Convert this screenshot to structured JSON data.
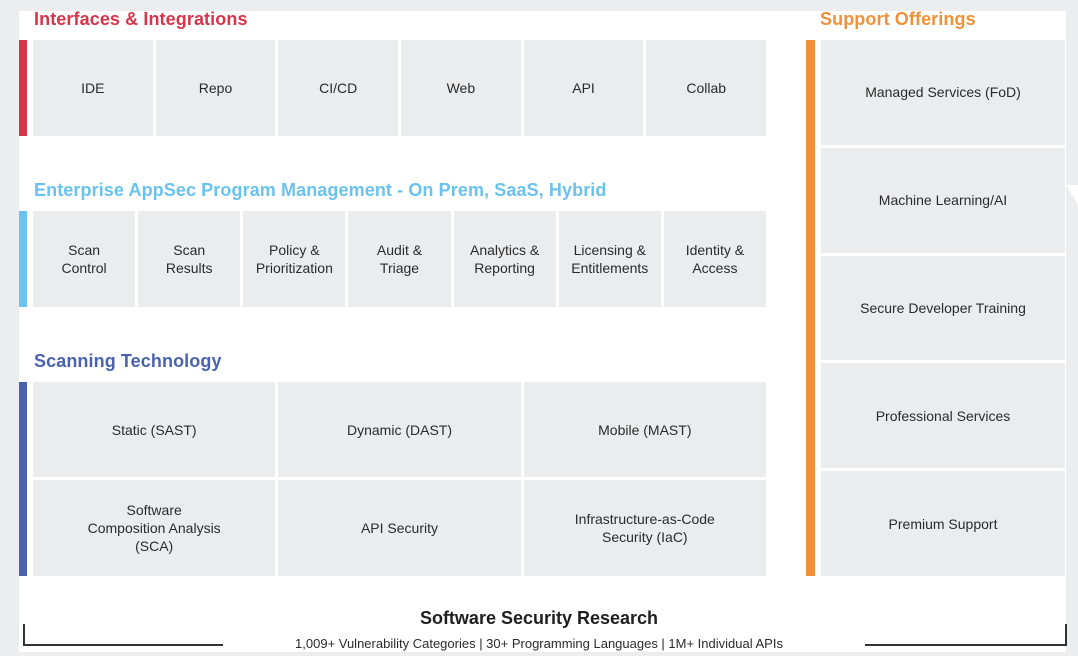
{
  "colors": {
    "interfaces": "#d9344a",
    "enterprise": "#6ac2ee",
    "scanning": "#4a63b0",
    "support": "#f0913a"
  },
  "interfaces": {
    "title": "Interfaces & Integrations",
    "items": [
      "IDE",
      "Repo",
      "CI/CD",
      "Web",
      "API",
      "Collab"
    ]
  },
  "enterprise": {
    "title": "Enterprise AppSec Program Management - On Prem, SaaS, Hybrid",
    "items": [
      "Scan\nControl",
      "Scan\nResults",
      "Policy &\nPrioritization",
      "Audit &\nTriage",
      "Analytics &\nReporting",
      "Licensing &\nEntitlements",
      "Identity &\nAccess"
    ]
  },
  "scanning": {
    "title": "Scanning Technology",
    "rows": [
      [
        "Static (SAST)",
        "Dynamic (DAST)",
        "Mobile (MAST)"
      ],
      [
        "Software\nComposition Analysis\n(SCA)",
        "API Security",
        "Infrastructure-as-Code\nSecurity (IaC)"
      ]
    ]
  },
  "support": {
    "title": "Support Offerings",
    "items": [
      "Managed Services (FoD)",
      "Machine Learning/AI",
      "Secure Developer Training",
      "Professional Services",
      "Premium Support"
    ]
  },
  "footer": {
    "title": "Software Security Research",
    "subtitle": "1,009+ Vulnerability Categories | 30+ Programming Languages | 1M+ Individual APIs"
  }
}
